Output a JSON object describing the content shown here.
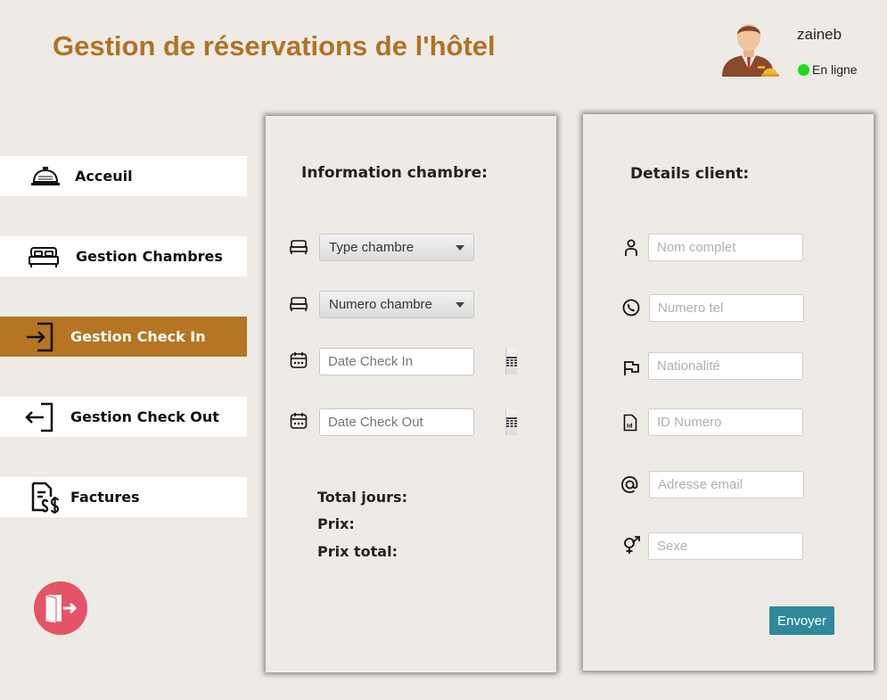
{
  "header": {
    "title": "Gestion de réservations de l'hôtel",
    "user_name": "zaineb",
    "status": "En ligne",
    "status_color": "#1bdb1b"
  },
  "sidebar": {
    "items": [
      {
        "label": "Acceuil",
        "icon": "service-bell-icon",
        "active": false
      },
      {
        "label": "Gestion Chambres",
        "icon": "bed-icon",
        "active": false
      },
      {
        "label": "Gestion Check In",
        "icon": "sign-in-icon",
        "active": true
      },
      {
        "label": "Gestion Check Out",
        "icon": "sign-out-icon",
        "active": false
      },
      {
        "label": "Factures",
        "icon": "invoice-icon",
        "active": false
      }
    ],
    "active_color": "#b57522",
    "logout_icon": "logout-door-icon"
  },
  "room_panel": {
    "title": "Information chambre:",
    "type_select": "Type chambre",
    "number_select": "Numero chambre",
    "checkin_placeholder": "Date Check In",
    "checkout_placeholder": "Date Check Out",
    "total_days_label": "Total jours:",
    "price_label": "Prix:",
    "total_price_label": "Prix total:"
  },
  "client_panel": {
    "title": "Details client:",
    "fields": [
      {
        "placeholder": "Nom complet",
        "icon": "person-icon"
      },
      {
        "placeholder": "Numero tel",
        "icon": "phone-icon"
      },
      {
        "placeholder": "Nationalité",
        "icon": "flag-icon"
      },
      {
        "placeholder": "ID Numero",
        "icon": "id-card-icon"
      },
      {
        "placeholder": "Adresse email",
        "icon": "at-sign-icon"
      },
      {
        "placeholder": "Sexe",
        "icon": "gender-icon"
      }
    ],
    "submit_label": "Envoyer",
    "submit_color": "#2e8a9a"
  }
}
